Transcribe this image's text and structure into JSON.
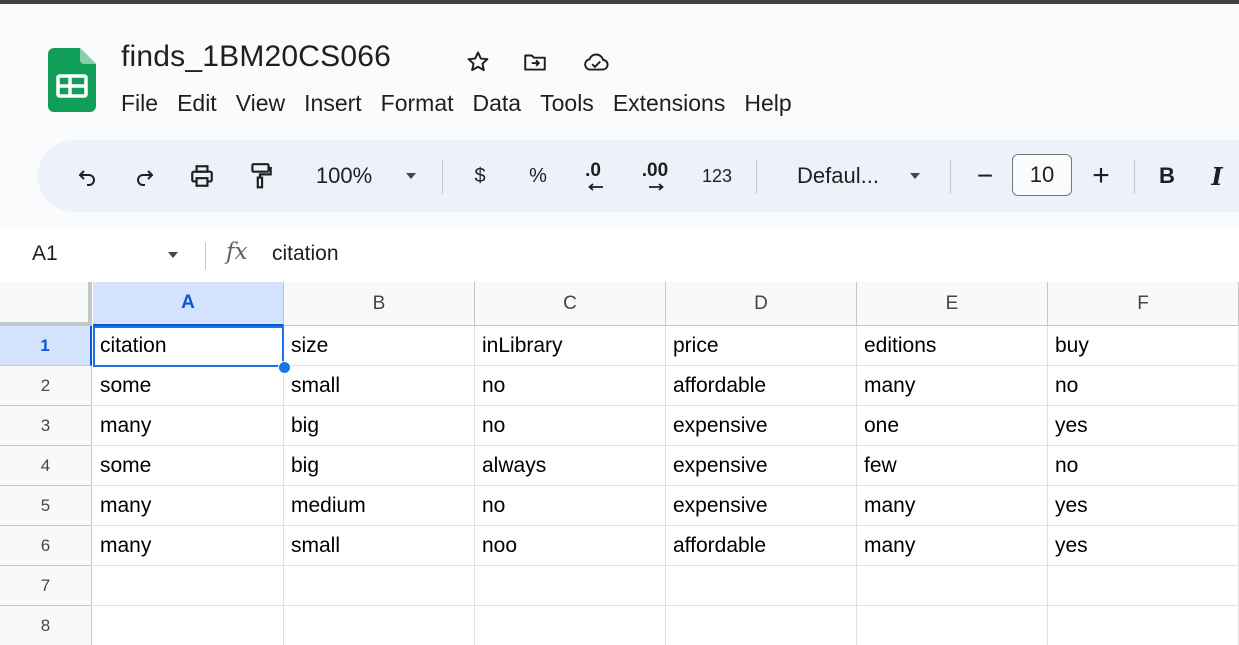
{
  "document": {
    "title": "finds_1BM20CS066"
  },
  "menu": [
    "File",
    "Edit",
    "View",
    "Insert",
    "Format",
    "Data",
    "Tools",
    "Extensions",
    "Help"
  ],
  "toolbar": {
    "zoom": "100%",
    "currency": "$",
    "percent": "%",
    "decrease_decimal": ".0",
    "increase_decimal": ".00",
    "number_format": "123",
    "font": "Defaul...",
    "minus": "−",
    "font_size": "10",
    "plus": "+",
    "bold": "B",
    "italic": "I"
  },
  "formula_bar": {
    "cell_ref": "A1",
    "fx": "fx",
    "value": "citation"
  },
  "grid": {
    "columns": [
      "A",
      "B",
      "C",
      "D",
      "E",
      "F"
    ],
    "row_numbers": [
      "1",
      "2",
      "3",
      "4",
      "5",
      "6",
      "7",
      "8"
    ],
    "rows": [
      [
        "citation",
        "size",
        "inLibrary",
        "price",
        "editions",
        "buy"
      ],
      [
        "some",
        "small",
        "no",
        "affordable",
        "many",
        "no"
      ],
      [
        "many",
        "big",
        "no",
        "expensive",
        "one",
        "yes"
      ],
      [
        "some",
        "big",
        "always",
        "expensive",
        "few",
        "no"
      ],
      [
        "many",
        "medium",
        "no",
        "expensive",
        "many",
        "yes"
      ],
      [
        "many",
        "small",
        "noo",
        "affordable",
        "many",
        "yes"
      ],
      [
        "",
        "",
        "",
        "",
        "",
        ""
      ],
      [
        "",
        "",
        "",
        "",
        "",
        ""
      ]
    ],
    "selected_cell": "A1"
  },
  "colors": {
    "accent": "#1a73e8",
    "selected_header": "#d3e3fd",
    "sheets_green": "#0f9d58"
  }
}
